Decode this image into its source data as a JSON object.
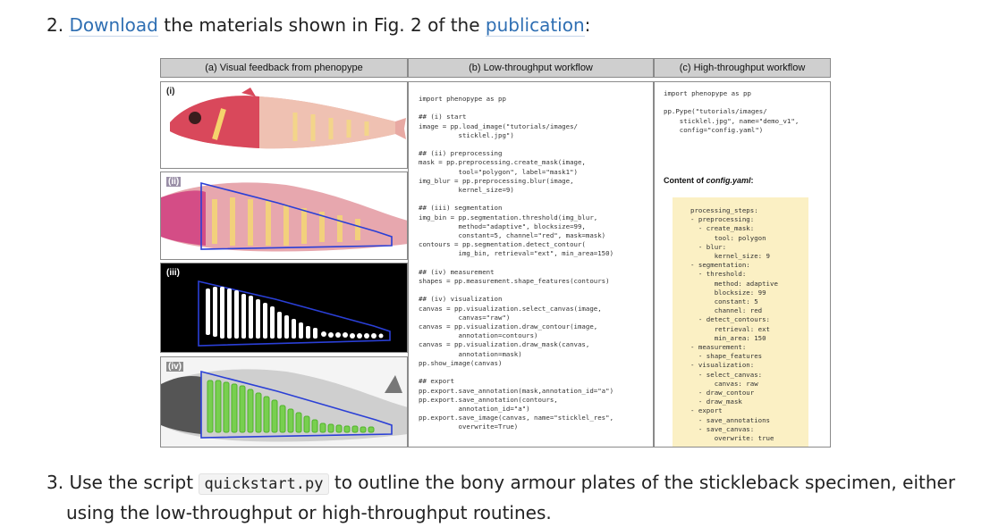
{
  "step2": {
    "number": "2.",
    "link1": "Download",
    "text_mid": "the materials shown in Fig. 2 of the",
    "link2": "publication",
    "text_end": ":"
  },
  "figure": {
    "columns": [
      "(a) Visual feedback from phenopype",
      "(b) Low-throughput workflow",
      "(c) High-throughput workflow"
    ],
    "row_labels": [
      "(i)",
      "(ii)",
      "(iii)",
      "(iv)"
    ],
    "low_throughput_code": "import phenopype as pp\n\n## (i) start\nimage = pp.load_image(\"tutorials/images/\n          sticklel.jpg\")\n\n## (ii) preprocessing\nmask = pp.preprocessing.create_mask(image,\n          tool=\"polygon\", label=\"mask1\")\nimg_blur = pp.preprocessing.blur(image,\n          kernel_size=9)\n\n## (iii) segmentation\nimg_bin = pp.segmentation.threshold(img_blur,\n          method=\"adaptive\", blocksize=99,\n          constant=5, channel=\"red\", mask=mask)\ncontours = pp.segmentation.detect_contour(\n          img_bin, retrieval=\"ext\", min_area=150)\n\n## (iv) measurement\nshapes = pp.measurement.shape_features(contours)\n\n## (iv) visualization\ncanvas = pp.visualization.select_canvas(image,\n          canvas=\"raw\")\ncanvas = pp.visualization.draw_contour(image,\n          annotation=contours)\ncanvas = pp.visualization.draw_mask(canvas,\n          annotation=mask)\npp.show_image(canvas)\n\n## export\npp.export.save_annotation(mask,annotation_id=\"a\")\npp.export.save_annotation(contours,\n          annotation_id=\"a\")\npp.export.save_image(canvas, name=\"sticklel_res\",\n          overwrite=True)",
    "high_throughput_code": "import phenopype as pp\n\npp.Pype(\"tutorials/images/\n    sticklel.jpg\", name=\"demo_v1\",\n    config=\"config.yaml\")",
    "config_title_prefix": "Content of ",
    "config_title_file": "config.yaml",
    "config_title_suffix": ":",
    "config_yaml": "processing_steps:\n- preprocessing:\n  - create_mask:\n      tool: polygon\n  - blur:\n      kernel_size: 9\n- segmentation:\n  - threshold:\n      method: adaptive\n      blocksize: 99\n      constant: 5\n      channel: red\n  - detect_contours:\n      retrieval: ext\n      min_area: 150\n- measurement:\n  - shape_features\n- visualization:\n  - select_canvas:\n      canvas: raw\n  - draw_contour\n  - draw_mask\n- export\n  - save_annotations\n  - save_canvas:\n      overwrite: true"
  },
  "step3": {
    "number": "3.",
    "text_before": "Use the script",
    "code": "quickstart.py",
    "text_after": "to outline the bony armour plates of the stickleback specimen, either",
    "text_line2": "using the low-throughput or high-throughput routines."
  },
  "colors": {
    "link": "#2f6fb3",
    "header_bg": "#cfcfcf",
    "yaml_bg": "#fbf0c4",
    "mask_outline": "#2a3fd6",
    "contour_green": "#5fd13a"
  }
}
